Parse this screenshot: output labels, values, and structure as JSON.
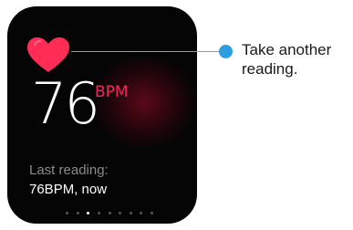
{
  "screen": {
    "heart_rate_value": "76",
    "heart_rate_unit": "BPM",
    "last_reading_label": "Last reading:",
    "last_reading_value": "76BPM, now",
    "heart_icon": "heart-icon",
    "page_indicator": {
      "count": 9,
      "active_index": 2
    }
  },
  "annotation": {
    "text": "Take another reading.",
    "marker_color": "#2d9ee0"
  },
  "colors": {
    "heart": "#ff2d55",
    "unit": "#f0285c",
    "screen_bg": "#050505"
  }
}
